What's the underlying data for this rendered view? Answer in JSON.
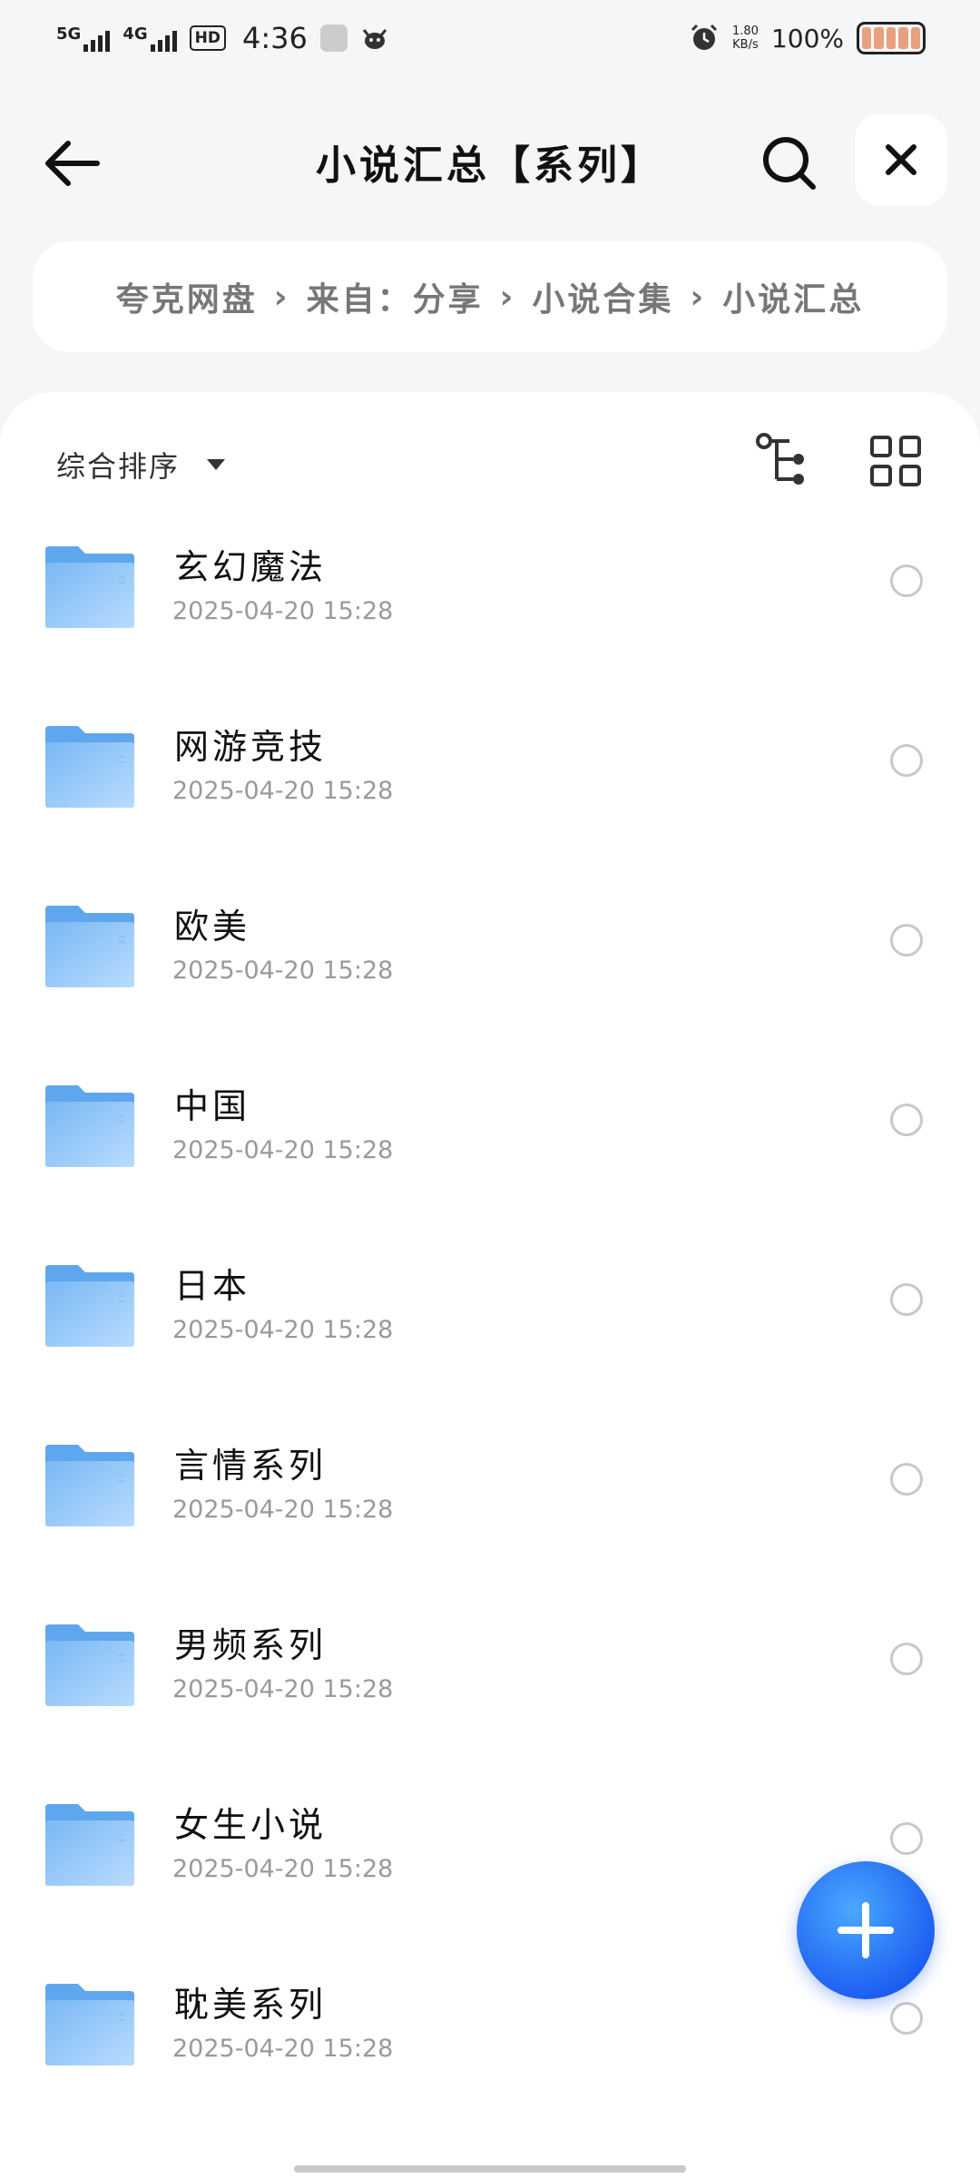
{
  "status_bar": {
    "net1": "5G",
    "net2": "4G",
    "hd_label": "HD",
    "time": "4:36",
    "speed_value": "1.80",
    "speed_unit": "KB/s",
    "battery_percent": "100%"
  },
  "header": {
    "title": "小说汇总【系列】"
  },
  "breadcrumb": {
    "items": [
      "夸克网盘",
      "来自：分享",
      "小说合集",
      "小说汇总"
    ],
    "separator": "›"
  },
  "toolbar": {
    "sort_label": "综合排序"
  },
  "files": [
    {
      "name": "玄幻魔法",
      "date": "2025-04-20 15:28"
    },
    {
      "name": "网游竞技",
      "date": "2025-04-20 15:28"
    },
    {
      "name": "欧美",
      "date": "2025-04-20 15:28"
    },
    {
      "name": "中国",
      "date": "2025-04-20 15:28"
    },
    {
      "name": "日本",
      "date": "2025-04-20 15:28"
    },
    {
      "name": "言情系列",
      "date": "2025-04-20 15:28"
    },
    {
      "name": "男频系列",
      "date": "2025-04-20 15:28"
    },
    {
      "name": "女生小说",
      "date": "2025-04-20 15:28"
    },
    {
      "name": "耽美系列",
      "date": "2025-04-20 15:28"
    }
  ],
  "colors": {
    "accent": "#1c5cf0",
    "folder": "#7ab8f5"
  }
}
